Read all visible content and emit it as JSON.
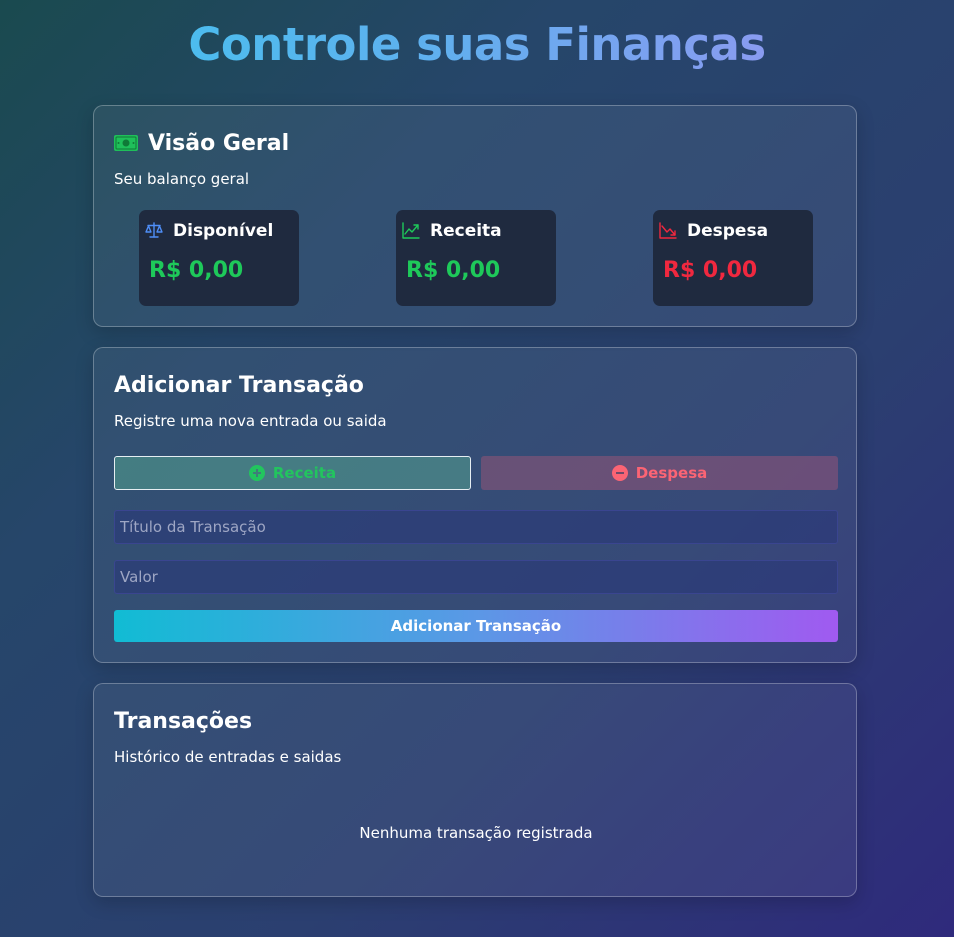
{
  "header": {
    "title": "Controle suas Finanças"
  },
  "overview": {
    "heading": "Visão Geral",
    "subtitle": "Seu balanço geral",
    "heading_icon": "money-bill-icon",
    "stats": [
      {
        "label": "Disponível",
        "value": "R$ 0,00",
        "icon": "scale-icon",
        "color": "#1ec95a"
      },
      {
        "label": "Receita",
        "value": "R$ 0,00",
        "icon": "trending-up-icon",
        "color": "#1ec95a"
      },
      {
        "label": "Despesa",
        "value": "R$ 0,00",
        "icon": "trending-down-icon",
        "color": "#f0283f"
      }
    ]
  },
  "add_transaction": {
    "heading": "Adicionar Transação",
    "subtitle": "Registre uma nova entrada ou saida",
    "type_buttons": {
      "income_label": "Receita",
      "income_icon": "plus-circle-icon",
      "expense_label": "Despesa",
      "expense_icon": "minus-circle-icon",
      "selected": "Receita"
    },
    "title_input": {
      "placeholder": "Título da Transação",
      "value": ""
    },
    "value_input": {
      "placeholder": "Valor",
      "value": ""
    },
    "submit_label": "Adicionar Transação"
  },
  "transactions": {
    "heading": "Transações",
    "subtitle": "Histórico de entradas e saidas",
    "empty_message": "Nenhuma transação registrada"
  },
  "colors": {
    "income": "#22c55e",
    "expense": "#f0283f",
    "accent_start": "#11bcd4",
    "accent_end": "#a05af0"
  }
}
